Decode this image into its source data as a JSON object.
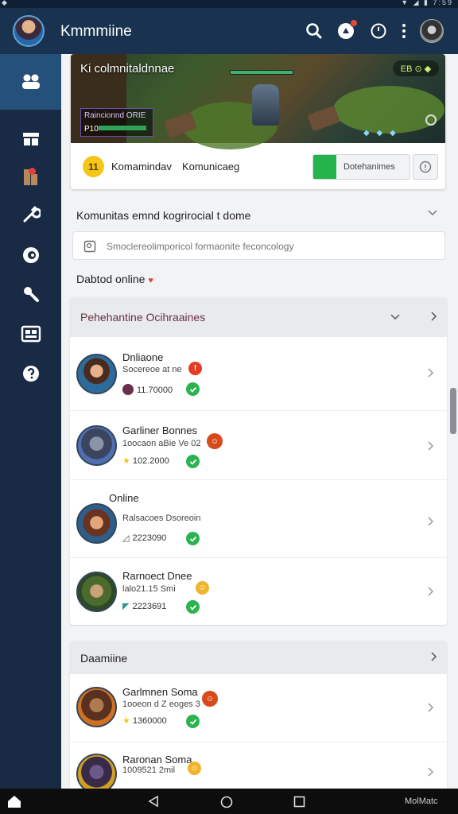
{
  "app": {
    "title": "Kmmmiine"
  },
  "status_bar": {
    "left": "◆",
    "right": "▼ ◢ ▮ 7:59"
  },
  "banner": {
    "title": "Ki colmnitaldnnae",
    "pill": "EB ⊙ ◆",
    "hud_label": "Raincionnd ORIE",
    "hud_value": "P10"
  },
  "feature_card": {
    "coin": "11",
    "label_left": "Komamindav",
    "label_right": "Komunicaeg",
    "button_label": "Dotehanimes"
  },
  "section": {
    "heading": "Komunitas emnd kogrirocial t dome"
  },
  "search": {
    "placeholder": "Smoclereolimporicol formaonite feconcology"
  },
  "online_header": {
    "label": "Dabtod online",
    "heart": "♥"
  },
  "list_panel": {
    "title": "Pehehantine Ocihraaines",
    "rows": [
      {
        "name": "Dnliaone",
        "sub": "Socereoe at ne",
        "stat": "11.70000",
        "badge_color": "#e23d22",
        "badge_text": "!"
      },
      {
        "name": "Garliner Bonnes",
        "sub": "1oocaon aBie Ve 02",
        "stat": "102.2000",
        "badge_color": "#d84a1c",
        "badge_text": "☺"
      },
      {
        "name": "Online",
        "sub": "Ralsacoes Dsoreoin",
        "stat": "2223090",
        "badge_color": "",
        "badge_text": ""
      },
      {
        "name": "Rarnoect Dnee",
        "sub": "lalo21.15 Smi",
        "stat": "2223691",
        "badge_color": "#f0b42a",
        "badge_text": "☺"
      }
    ]
  },
  "panel2": {
    "title": "Daamiine",
    "rows": [
      {
        "name": "Garlmnen Soma",
        "sub": "1ooeon d Z eoges 3",
        "stat": "1360000",
        "badge_color": "#d84a1c",
        "badge_text": "☺"
      },
      {
        "name": "Raronan Soma",
        "sub": "1009521 2mil",
        "stat": "",
        "badge_color": "#f0b42a",
        "badge_text": "☺"
      }
    ]
  },
  "navbar": {
    "brand": "MolMatc"
  },
  "colors": {
    "appbar": "#18324f",
    "sidebar": "#192b44",
    "accent_green": "#25b34b",
    "alert_red": "#e44b34"
  },
  "icons": [
    "search-icon",
    "notification-icon",
    "clock-icon",
    "more-vertical-icon",
    "community-icon",
    "store-icon",
    "character-icon",
    "wrench-icon",
    "eye-icon",
    "tools-icon",
    "card-icon",
    "help-icon"
  ]
}
